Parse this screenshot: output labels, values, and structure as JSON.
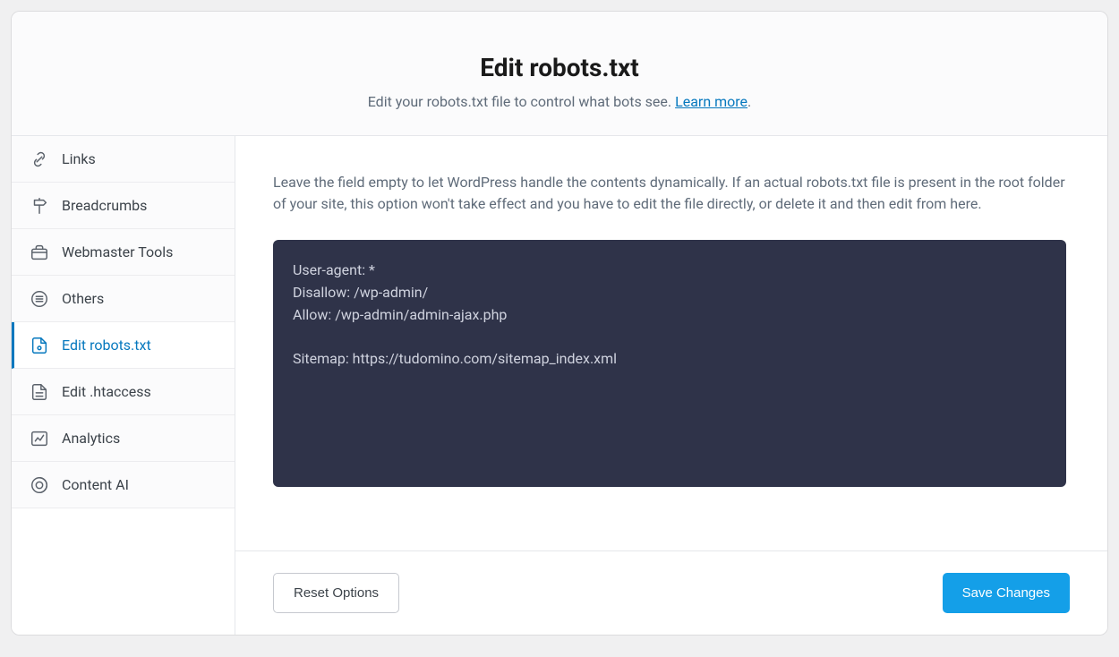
{
  "header": {
    "title": "Edit robots.txt",
    "subtitle_prefix": "Edit your robots.txt file to control what bots see. ",
    "learn_more": "Learn more",
    "subtitle_suffix": "."
  },
  "sidebar": {
    "items": [
      {
        "label": "Links"
      },
      {
        "label": "Breadcrumbs"
      },
      {
        "label": "Webmaster Tools"
      },
      {
        "label": "Others"
      },
      {
        "label": "Edit robots.txt"
      },
      {
        "label": "Edit .htaccess"
      },
      {
        "label": "Analytics"
      },
      {
        "label": "Content AI"
      }
    ]
  },
  "main": {
    "helptext": "Leave the field empty to let WordPress handle the contents dynamically. If an actual robots.txt file is present in the root folder of your site, this option won't take effect and you have to edit the file directly, or delete it and then edit from here.",
    "editor_value": "User-agent: *\nDisallow: /wp-admin/\nAllow: /wp-admin/admin-ajax.php\n\nSitemap: https://tudomino.com/sitemap_index.xml"
  },
  "footer": {
    "reset_label": "Reset Options",
    "save_label": "Save Changes"
  }
}
